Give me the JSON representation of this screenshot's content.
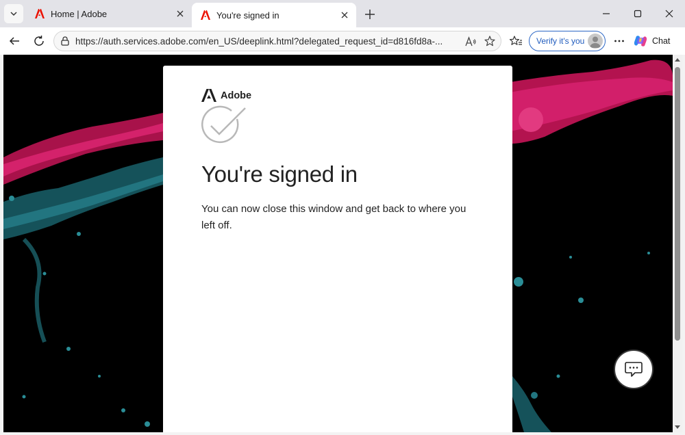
{
  "tabs": [
    {
      "title": "Home | Adobe",
      "active": false,
      "favicon": "adobe-logo-icon"
    },
    {
      "title": "You're signed in",
      "active": true,
      "favicon": "adobe-logo-icon"
    }
  ],
  "toolbar": {
    "url": "https://auth.services.adobe.com/en_US/deeplink.html?delegated_request_id=d816fd8a-...",
    "verify_label": "Verify it's you",
    "chat_label": "Chat"
  },
  "page": {
    "brand": "Adobe",
    "title": "You're signed in",
    "description": "You can now close this window and get back to where you left off."
  },
  "colors": {
    "adobe_red": "#eb1000",
    "verify_blue": "#1f5bbd",
    "page_background": "#000000",
    "splash_pink": "#c8195e",
    "splash_teal": "#1f6e74"
  }
}
